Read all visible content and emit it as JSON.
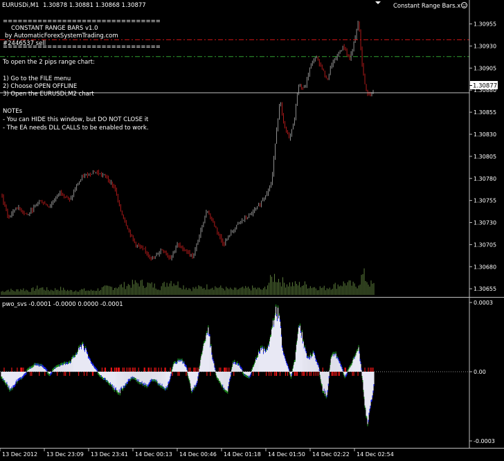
{
  "header": {
    "symbol_label": "EURUSDi,M1",
    "ohlc": "1.30878 1.30881 1.30868 1.30877",
    "ea_title": "Constant Range Bars.x"
  },
  "ea_info": {
    "separator_top": "================================",
    "name_line": "CONSTANT RANGE BARS v1.0",
    "by_line": "by AutomaticForexSystemTrading.com",
    "order_line": "#2446537 sell",
    "separator_bottom": "================================",
    "instructions_title": "To open the 2 pips range chart:",
    "steps": [
      "1) Go to the FILE menu",
      "2) Choose OPEN OFFLINE",
      "3) Open the EURUSDi,M2 chart"
    ],
    "notes_title": "NOTEs",
    "notes": [
      "- You can HIDE this window, but DO NOT CLOSE it",
      "- The EA needs DLL CALLS to be enabled to work."
    ]
  },
  "current_price": "1.30877",
  "indicator": {
    "label": "pwo_svs -0.0001 -0.0000 0.0000 -0.0001"
  },
  "colors": {
    "background": "#000000",
    "bull_candle": "#8f8f8f",
    "bear_candle": "#b11a1a",
    "volume": "#5a7a3a",
    "grid_line": "#c0c0c0",
    "price_line": "#c0c0c0",
    "red_level": "#c81414",
    "green_level": "#30a030",
    "histogram_body": "#e8e8f4",
    "histogram_blue": "#1a24e8",
    "histogram_red": "#e81414",
    "histogram_green": "#1a8a1a"
  },
  "chart_data": [
    {
      "type": "candlestick",
      "timeframe": "M1",
      "price_ticks": [
        "1.30955",
        "1.30930",
        "1.30905",
        "1.30880",
        "1.30855",
        "1.30830",
        "1.30805",
        "1.30780",
        "1.30755",
        "1.30730",
        "1.30705",
        "1.30680",
        "1.30655"
      ],
      "ylim": [
        1.30652,
        1.30968
      ],
      "levels": {
        "red_dash": 1.30937,
        "green_dash": 1.30918,
        "price_line": 1.30877
      },
      "price_path": [
        [
          0,
          1.30762
        ],
        [
          10,
          1.30735
        ],
        [
          22,
          1.30748
        ],
        [
          38,
          1.30738
        ],
        [
          55,
          1.30755
        ],
        [
          70,
          1.30748
        ],
        [
          85,
          1.30765
        ],
        [
          100,
          1.30755
        ],
        [
          108,
          1.3077
        ],
        [
          118,
          1.30782
        ],
        [
          135,
          1.30788
        ],
        [
          152,
          1.30782
        ],
        [
          165,
          1.30768
        ],
        [
          172,
          1.30745
        ],
        [
          185,
          1.3072
        ],
        [
          195,
          1.30705
        ],
        [
          208,
          1.30698
        ],
        [
          220,
          1.30688
        ],
        [
          232,
          1.307
        ],
        [
          245,
          1.3069
        ],
        [
          255,
          1.30705
        ],
        [
          268,
          1.30698
        ],
        [
          278,
          1.3069
        ],
        [
          285,
          1.3071
        ],
        [
          298,
          1.30745
        ],
        [
          310,
          1.30725
        ],
        [
          322,
          1.30705
        ],
        [
          330,
          1.30715
        ],
        [
          345,
          1.3073
        ],
        [
          360,
          1.30738
        ],
        [
          372,
          1.30748
        ],
        [
          382,
          1.3076
        ],
        [
          392,
          1.30775
        ],
        [
          398,
          1.3083
        ],
        [
          404,
          1.30868
        ],
        [
          410,
          1.30838
        ],
        [
          418,
          1.30825
        ],
        [
          425,
          1.30848
        ],
        [
          430,
          1.30885
        ],
        [
          440,
          1.30882
        ],
        [
          448,
          1.30908
        ],
        [
          456,
          1.30918
        ],
        [
          465,
          1.30905
        ],
        [
          472,
          1.3089
        ],
        [
          478,
          1.30908
        ],
        [
          488,
          1.3092
        ],
        [
          496,
          1.3093
        ],
        [
          505,
          1.30915
        ],
        [
          512,
          1.30935
        ],
        [
          518,
          1.3096
        ],
        [
          522,
          1.30915
        ],
        [
          528,
          1.3088
        ],
        [
          534,
          1.30875
        ],
        [
          540,
          1.30877
        ]
      ],
      "volume": [
        [
          0,
          0.1
        ],
        [
          10,
          0.15
        ],
        [
          20,
          0.12
        ],
        [
          30,
          0.18
        ],
        [
          40,
          0.12
        ],
        [
          55,
          0.22
        ],
        [
          70,
          0.14
        ],
        [
          85,
          0.18
        ],
        [
          100,
          0.12
        ],
        [
          115,
          0.15
        ],
        [
          130,
          0.12
        ],
        [
          150,
          0.2
        ],
        [
          170,
          0.25
        ],
        [
          185,
          0.3
        ],
        [
          200,
          0.35
        ],
        [
          215,
          0.3
        ],
        [
          230,
          0.22
        ],
        [
          245,
          0.42
        ],
        [
          260,
          0.28
        ],
        [
          275,
          0.18
        ],
        [
          290,
          0.22
        ],
        [
          305,
          0.25
        ],
        [
          320,
          0.2
        ],
        [
          335,
          0.15
        ],
        [
          350,
          0.18
        ],
        [
          365,
          0.2
        ],
        [
          380,
          0.15
        ],
        [
          395,
          0.55
        ],
        [
          410,
          0.35
        ],
        [
          425,
          0.3
        ],
        [
          440,
          0.3
        ],
        [
          455,
          0.22
        ],
        [
          470,
          0.2
        ],
        [
          485,
          0.28
        ],
        [
          500,
          0.35
        ],
        [
          515,
          0.25
        ],
        [
          525,
          0.6
        ],
        [
          532,
          0.35
        ],
        [
          540,
          0.28
        ]
      ]
    },
    {
      "type": "histogram",
      "name": "pwo_svs",
      "y_ticks": [
        "0.0003",
        "0.00",
        "-0.0003"
      ],
      "ylim": [
        -0.0003,
        0.0003
      ],
      "x_tick_labels": [
        "13 Dec 2012",
        "13 Dec 23:09",
        "13 Dec 23:41",
        "14 Dec 00:13",
        "14 Dec 00:46",
        "14 Dec 01:18",
        "14 Dec 01:50",
        "14 Dec 02:22",
        "14 Dec 02:54"
      ],
      "values": [
        [
          0,
          -2e-05
        ],
        [
          8,
          -5e-05
        ],
        [
          14,
          -8e-05
        ],
        [
          22,
          -4e-05
        ],
        [
          30,
          -2e-05
        ],
        [
          40,
          1e-05
        ],
        [
          50,
          3e-05
        ],
        [
          60,
          2e-05
        ],
        [
          70,
          -1e-05
        ],
        [
          80,
          2e-05
        ],
        [
          90,
          3e-05
        ],
        [
          100,
          4e-05
        ],
        [
          110,
          8e-05
        ],
        [
          118,
          0.00012
        ],
        [
          126,
          6e-05
        ],
        [
          134,
          2e-05
        ],
        [
          142,
          -1e-05
        ],
        [
          150,
          -3e-05
        ],
        [
          160,
          -6e-05
        ],
        [
          170,
          -9e-05
        ],
        [
          180,
          -5e-05
        ],
        [
          190,
          -2e-05
        ],
        [
          200,
          -4e-05
        ],
        [
          210,
          -6e-05
        ],
        [
          220,
          -3e-05
        ],
        [
          230,
          -5e-05
        ],
        [
          240,
          -7e-05
        ],
        [
          250,
          3e-05
        ],
        [
          260,
          5e-05
        ],
        [
          268,
          2e-05
        ],
        [
          276,
          -8e-05
        ],
        [
          284,
          -4e-05
        ],
        [
          292,
          0.0001
        ],
        [
          300,
          0.00018
        ],
        [
          306,
          6e-05
        ],
        [
          312,
          -2e-05
        ],
        [
          320,
          -6e-05
        ],
        [
          328,
          -8e-05
        ],
        [
          336,
          4e-05
        ],
        [
          344,
          3e-05
        ],
        [
          352,
          -1e-05
        ],
        [
          360,
          -2e-05
        ],
        [
          368,
          4e-05
        ],
        [
          376,
          0.0001
        ],
        [
          384,
          8e-05
        ],
        [
          390,
          0.00014
        ],
        [
          396,
          0.00024
        ],
        [
          402,
          0.00026
        ],
        [
          408,
          8e-05
        ],
        [
          414,
          3e-05
        ],
        [
          420,
          -2e-05
        ],
        [
          426,
          5e-05
        ],
        [
          432,
          0.00022
        ],
        [
          438,
          0.00012
        ],
        [
          444,
          5e-05
        ],
        [
          452,
          8e-05
        ],
        [
          460,
          2e-05
        ],
        [
          466,
          -8e-05
        ],
        [
          472,
          -0.0001
        ],
        [
          478,
          6e-05
        ],
        [
          484,
          8e-05
        ],
        [
          490,
          4e-05
        ],
        [
          498,
          -2e-05
        ],
        [
          506,
          2e-05
        ],
        [
          512,
          6e-05
        ],
        [
          518,
          0.0001
        ],
        [
          524,
          -4e-05
        ],
        [
          528,
          -0.00018
        ],
        [
          532,
          -0.00022
        ],
        [
          536,
          -0.00014
        ],
        [
          540,
          -6e-05
        ]
      ]
    }
  ]
}
